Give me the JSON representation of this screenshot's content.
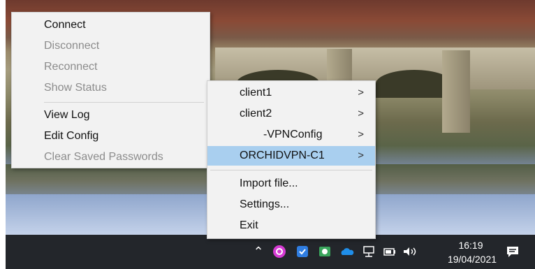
{
  "main_menu": {
    "items": [
      {
        "label": "Connect",
        "enabled": true
      },
      {
        "label": "Disconnect",
        "enabled": false
      },
      {
        "label": "Reconnect",
        "enabled": false
      },
      {
        "label": "Show Status",
        "enabled": false
      },
      {
        "label": "View Log",
        "enabled": true
      },
      {
        "label": "Edit Config",
        "enabled": true
      },
      {
        "label": "Clear Saved Passwords",
        "enabled": false
      }
    ]
  },
  "config_menu": {
    "items": [
      {
        "label": "client1",
        "submenu": true
      },
      {
        "label": "client2",
        "submenu": true
      },
      {
        "label": "-VPNConfig",
        "submenu": true
      },
      {
        "label": "ORCHIDVPN-C1",
        "submenu": true,
        "highlighted": true
      },
      {
        "label": "Import file...",
        "submenu": false
      },
      {
        "label": "Settings...",
        "submenu": false
      },
      {
        "label": "Exit",
        "submenu": false
      }
    ],
    "submenu_arrow": ">"
  },
  "taskbar": {
    "tray_icons": [
      "chevron-up-icon",
      "openvpn-icon",
      "shield-icon",
      "network-app-icon",
      "onedrive-cloud-icon",
      "network-icon",
      "battery-icon",
      "volume-icon"
    ],
    "clock": {
      "time": "16:19",
      "date": "19/04/2021"
    },
    "notification_icon": "action-center-icon"
  },
  "colors": {
    "highlight": "#a9cfef",
    "taskbar": "#23262b",
    "menu_bg": "#f2f2f2",
    "disabled_text": "#8c8c8c"
  }
}
